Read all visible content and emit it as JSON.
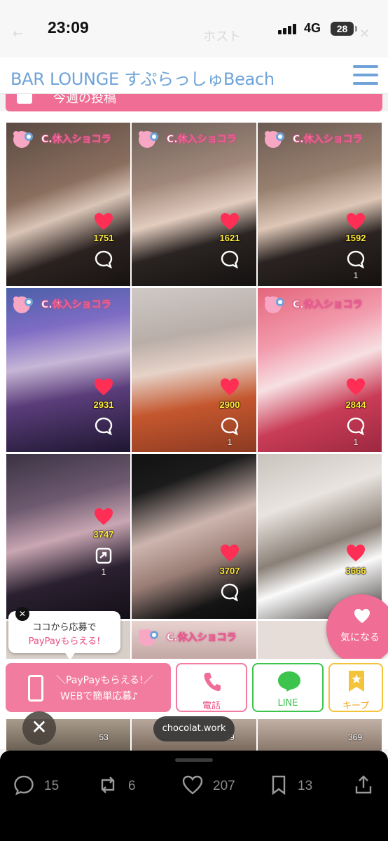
{
  "status_bar": {
    "time": "23:09",
    "network": "4G",
    "battery": "28"
  },
  "header": {
    "title": "BAR LOUNGE すぷらっしゅBeach"
  },
  "section": {
    "title": "今週の投稿"
  },
  "stamp_text": "C.休入ショコラ",
  "posts": [
    {
      "likes": "1751",
      "comments": ""
    },
    {
      "likes": "1621",
      "comments": ""
    },
    {
      "likes": "1592",
      "comments": "1"
    },
    {
      "likes": "2931",
      "comments": ""
    },
    {
      "likes": "2900",
      "comments": "1"
    },
    {
      "likes": "2844",
      "comments": "1"
    },
    {
      "likes": "3747",
      "comments": "1"
    },
    {
      "likes": "3707",
      "comments": ""
    },
    {
      "likes": "3666",
      "comments": ""
    }
  ],
  "bottom_row": [
    {
      "count": "53"
    },
    {
      "count": "99"
    },
    {
      "count": "369"
    }
  ],
  "tooltip": {
    "line1": "ココから応募で",
    "line2": "PayPayもらえる!"
  },
  "apply_button": {
    "line1": "＼PayPayもらえる!／",
    "line2": "WEBで簡単応募♪"
  },
  "phone_button": {
    "label": "電話"
  },
  "line_button": {
    "label": "LINE"
  },
  "keep_button": {
    "label": "キープ"
  },
  "favorite_button": {
    "label": "気になる"
  },
  "domain_pill": {
    "text": "chocolat.work"
  },
  "social": {
    "replies": "15",
    "reposts": "6",
    "likes": "207",
    "bookmarks": "13"
  },
  "colors": {
    "brand_pink": "#f06d95",
    "title_blue": "#6fa3d8",
    "line_green": "#3cc44d",
    "keep_yellow": "#f3c43a",
    "like_red": "#ff2e55"
  }
}
